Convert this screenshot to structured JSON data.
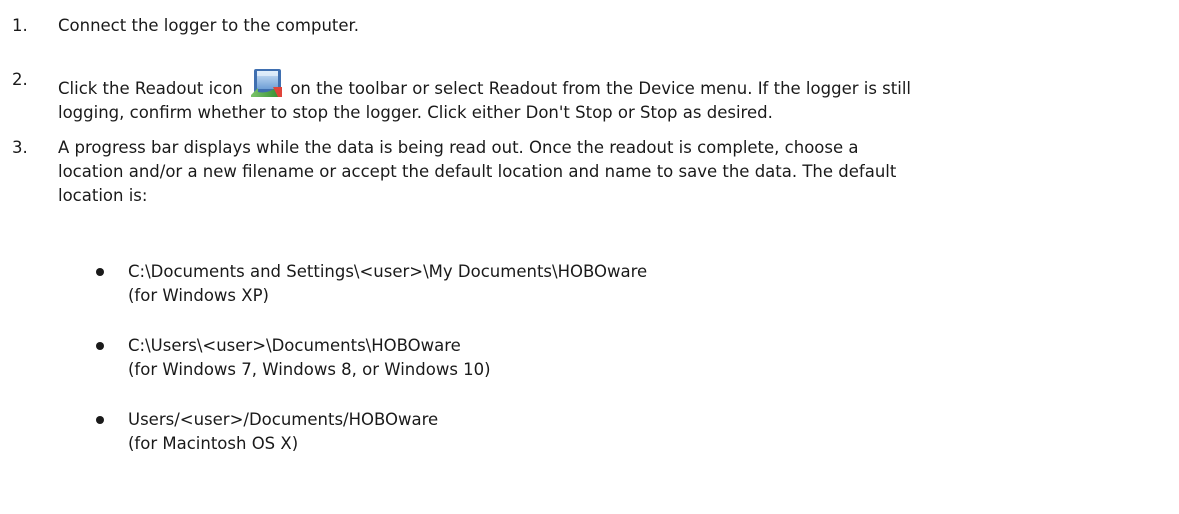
{
  "steps": [
    {
      "number": "1.",
      "lines": [
        "Connect the logger to the computer."
      ]
    },
    {
      "number": "2.",
      "line1_before_icon": "Click the Readout icon",
      "icon": "readout-icon",
      "line1_after_icon": "on the toolbar or select Readout from the Device menu. If the logger is still",
      "line2": "logging, confirm whether to stop the logger. Click either Don't Stop or Stop as desired."
    },
    {
      "number": "3.",
      "lines": [
        "A progress bar displays while the data is being read out. Once the readout is complete, choose a",
        "location and/or a new filename or accept the default location and name to save the data. The default",
        "location is:"
      ]
    }
  ],
  "locations": [
    {
      "path": "C:\\Documents and Settings\\<user>\\My Documents\\HOBOware",
      "note": "(for Windows XP)"
    },
    {
      "path": "C:\\Users\\<user>\\Documents\\HOBOware",
      "note": "(for Windows 7, Windows 8, or Windows 10)"
    },
    {
      "path": "Users/<user>/Documents/HOBOware",
      "note": "(for Macintosh OS X)"
    }
  ]
}
